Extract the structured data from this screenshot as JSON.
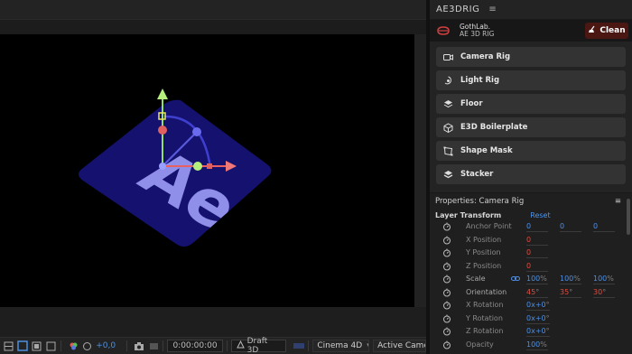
{
  "panel": {
    "title": "AE3DRIG",
    "menu_glyph": "≡",
    "brand_name": "GothLab.",
    "brand_sub": "AE 3D RIG",
    "clean_label": "Clean"
  },
  "tools": [
    {
      "label": "Camera Rig",
      "icon": "camera-icon"
    },
    {
      "label": "Light Rig",
      "icon": "light-icon"
    },
    {
      "label": "Floor",
      "icon": "layers-icon"
    },
    {
      "label": "E3D Boilerplate",
      "icon": "cube-icon"
    },
    {
      "label": "Shape Mask",
      "icon": "mask-icon"
    },
    {
      "label": "Stacker",
      "icon": "stack-icon"
    }
  ],
  "properties": {
    "title": "Properties: Camera Rig",
    "section": "Layer Transform",
    "reset_label": "Reset",
    "rows": [
      {
        "name": "Anchor Point",
        "values": [
          "0",
          "0",
          "0"
        ]
      },
      {
        "name": "X Position",
        "values": [
          "0"
        ]
      },
      {
        "name": "Y Position",
        "values": [
          "0"
        ]
      },
      {
        "name": "Z Position",
        "values": [
          "0"
        ]
      },
      {
        "name": "Scale",
        "values": [
          "100",
          "100",
          "100"
        ],
        "unit": "%"
      },
      {
        "name": "Orientation",
        "values": [
          "45",
          "35",
          "30"
        ],
        "unit": "°"
      },
      {
        "name": "X Rotation",
        "values": [
          "0x+0"
        ],
        "unit": "°"
      },
      {
        "name": "Y Rotation",
        "values": [
          "0x+0"
        ],
        "unit": "°"
      },
      {
        "name": "Z Rotation",
        "values": [
          "0x+0"
        ],
        "unit": "°"
      },
      {
        "name": "Opacity",
        "values": [
          "100"
        ],
        "unit": "%"
      }
    ]
  },
  "bottom_bar": {
    "exposure": "+0,0",
    "timecode": "0:00:00:00",
    "draft_label": "Draft 3D",
    "renderer": "Cinema 4D",
    "camera": "Active Camer..."
  },
  "viewport": {
    "logo_text": "Ae",
    "tile_color": "#14126e",
    "logo_color": "#8f8ee8"
  }
}
